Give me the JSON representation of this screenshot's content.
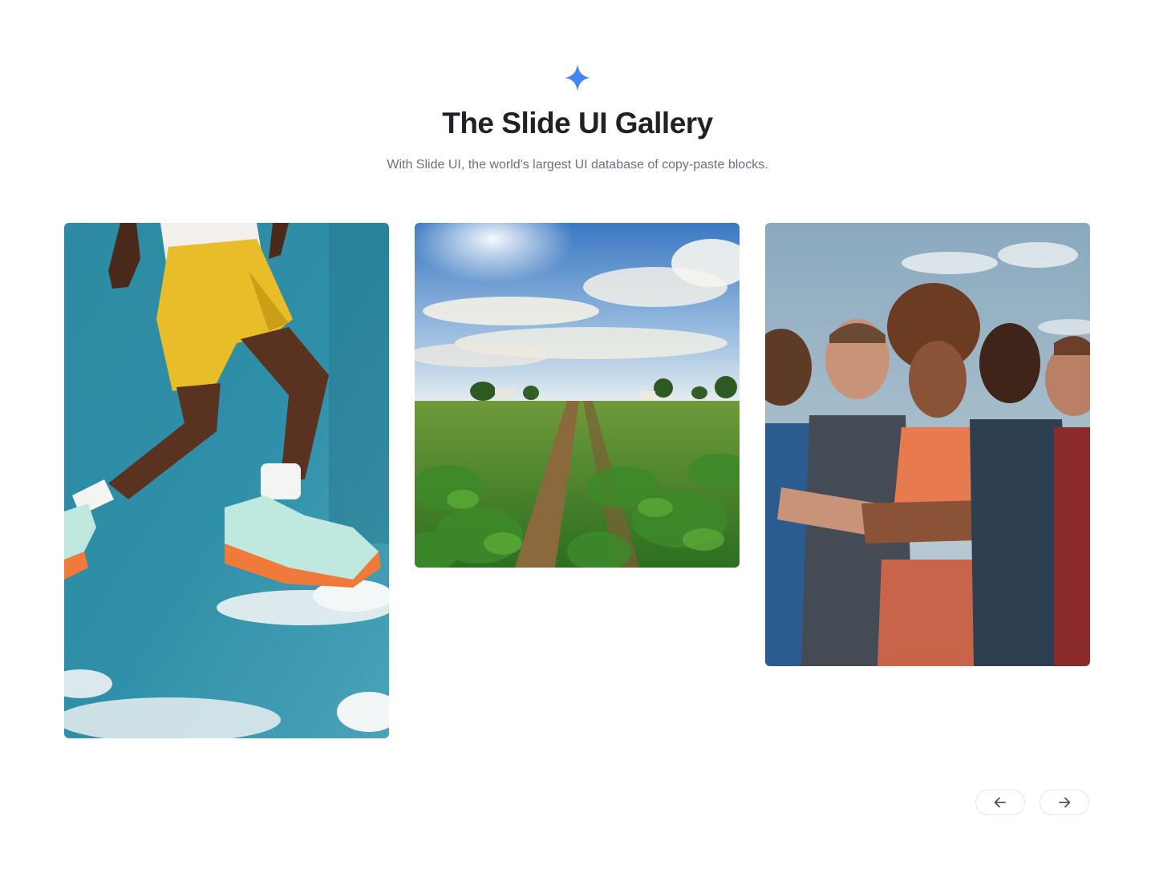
{
  "header": {
    "icon": "sparkle-icon",
    "title": "The Slide UI Gallery",
    "subtitle": "With Slide UI, the world's largest UI database of copy-paste blocks."
  },
  "gallery": {
    "items": [
      {
        "name": "jumping-runner-photo",
        "alt": "Runner in yellow shorts and sneakers jumping against blue sky"
      },
      {
        "name": "farm-field-photo",
        "alt": "Rows of green crops under a sunny cloudy sky"
      },
      {
        "name": "athletes-group-photo",
        "alt": "Group of athletes standing with arms crossed"
      }
    ]
  },
  "navigation": {
    "prev_icon": "arrow-left-icon",
    "next_icon": "arrow-right-icon"
  },
  "colors": {
    "accent": "#4285f4",
    "title": "#1f2328",
    "subtitle": "#6b7280",
    "button_border": "#e5e7eb"
  }
}
